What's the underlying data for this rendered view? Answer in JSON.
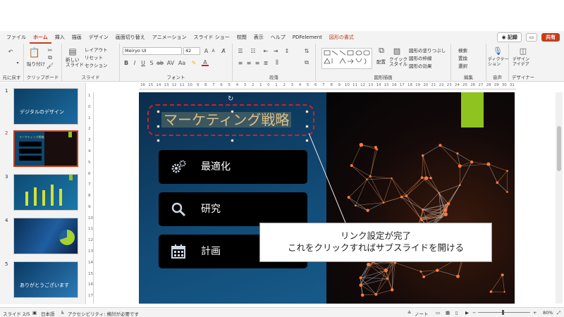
{
  "menu": {
    "tabs": [
      "ファイル",
      "ホーム",
      "挿入",
      "描画",
      "デザイン",
      "画面切り替え",
      "アニメーション",
      "スライド ショー",
      "校閲",
      "表示",
      "ヘルプ",
      "PDFelement",
      "図形の書式"
    ],
    "record": "◉ 記録",
    "share": "共有"
  },
  "ribbon": {
    "groups": {
      "undo": "元に戻す",
      "clipboard": "クリップボード",
      "slides": "スライド",
      "font": "フォント",
      "paragraph": "段落",
      "drawing": "図形描画",
      "editing": "編集",
      "voice": "音声",
      "designer": "デザイナー"
    },
    "paste": "貼り付け",
    "new_slide": "新しい\nスライド",
    "layout": "レイアウト",
    "reset": "リセット",
    "section": "セクション",
    "font_name": "Meiryo UI",
    "font_size": "42",
    "arrange": "配置",
    "quick_styles": "クイック\nスタイル",
    "shape_fill": "図形の塗りつぶし",
    "shape_outline": "図形の枠線",
    "shape_effects": "図形の効果",
    "find": "検索",
    "replace": "置換",
    "select": "選択",
    "dictate": "ディクテー\nション",
    "design_ideas": "デザイン\nアイデア"
  },
  "ruler": {
    "h": [
      "16",
      "15",
      "14",
      "13",
      "12",
      "11",
      "10",
      "9",
      "8",
      "7",
      "6",
      "5",
      "4",
      "3",
      "2",
      "1",
      "0",
      "1",
      "2",
      "3",
      "4",
      "5",
      "6",
      "7",
      "8",
      "9",
      "10",
      "11",
      "12",
      "13",
      "14",
      "15",
      "16",
      "17",
      "18",
      "19",
      "20",
      "21",
      "22",
      "23",
      "24",
      "25",
      "26",
      "27",
      "28",
      "29",
      "30",
      "31"
    ],
    "v": [
      "1",
      "0",
      "1",
      "2",
      "3",
      "4",
      "5",
      "6",
      "7",
      "8",
      "9",
      "10",
      "11",
      "12",
      "13",
      "14",
      "15",
      "16",
      "17"
    ]
  },
  "thumbnails": [
    {
      "num": "1",
      "title": "デジタルのデザイン"
    },
    {
      "num": "2",
      "title": "マーケティング戦略"
    },
    {
      "num": "3",
      "title": ""
    },
    {
      "num": "4",
      "title": ""
    },
    {
      "num": "5",
      "title": "ありがとうございます"
    }
  ],
  "slide": {
    "title": "マーケティング戦略",
    "items": [
      {
        "label": "最適化",
        "icon": "gears-icon"
      },
      {
        "label": "研究",
        "icon": "magnifier-icon"
      },
      {
        "label": "計画",
        "icon": "calendar-icon"
      }
    ],
    "accent": "#8fc31f"
  },
  "callout": {
    "line1": "リンク設定が完了",
    "line2": "これをクリックすればサブスライドを開ける"
  },
  "status": {
    "slide": "スライド 2/5",
    "language": "日本語",
    "accessibility": "アクセシビリティ: 検討が必要です",
    "notes": "ノート",
    "zoom": "80%"
  }
}
